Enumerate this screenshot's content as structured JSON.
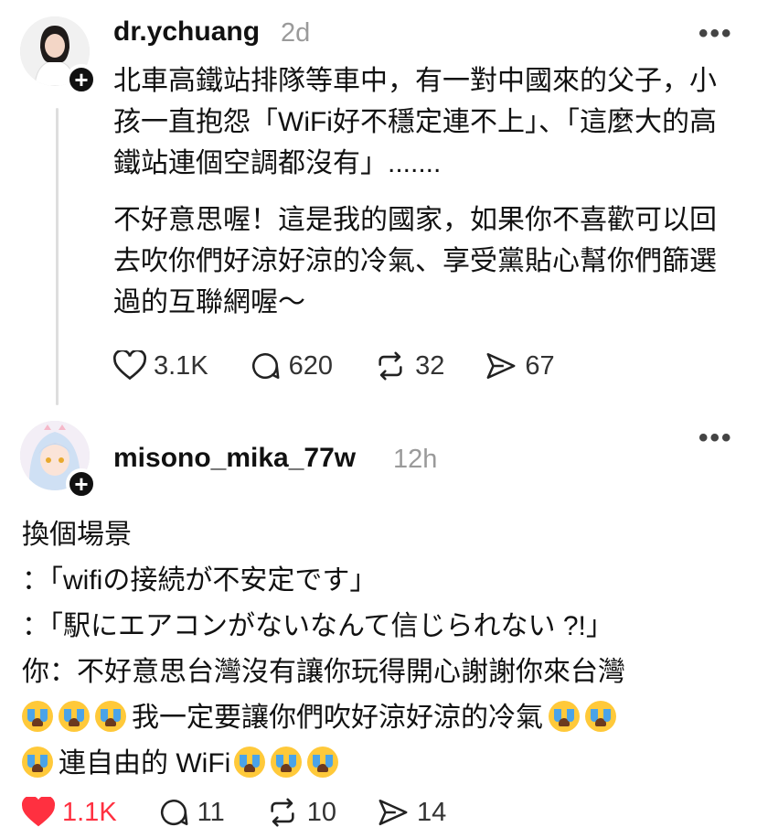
{
  "post1": {
    "username": "dr.ychuang",
    "time": "2d",
    "more": "•••",
    "paragraph1": "北車高鐵站排隊等車中，有一對中國來的父子，小孩一直抱怨「WiFi好不穩定連不上」、「這麼大的高鐵站連個空調都沒有」.......",
    "paragraph2": "不好意思喔！這是我的國家，如果你不喜歡可以回去吹你們好涼好涼的冷氣、享受黨貼心幫你們篩選過的互聯網喔～",
    "likes": "3.1K",
    "comments": "620",
    "reposts": "32",
    "shares": "67"
  },
  "post2": {
    "username": "misono_mika_77w",
    "time": "12h",
    "more": "•••",
    "line1": "換個場景",
    "line2": "：「wifiの接続が不安定です」",
    "line3": "：「駅にエアコンがないなんて信じられない ?!」",
    "line4": "你：不好意思台灣沒有讓你玩得開心謝謝你來台灣",
    "line5": "我一定要讓你們吹好涼好涼的冷氣",
    "line6": "連自由的 WiFi",
    "likes": "1.1K",
    "comments": "11",
    "reposts": "10",
    "shares": "14"
  },
  "colors": {
    "liked": "#ff3040",
    "text": "#111111",
    "muted": "#9a9a9a"
  },
  "icons": [
    "heart-icon",
    "comment-icon",
    "repost-icon",
    "share-icon",
    "plus-icon",
    "more-icon",
    "loudly-crying-face-icon"
  ]
}
